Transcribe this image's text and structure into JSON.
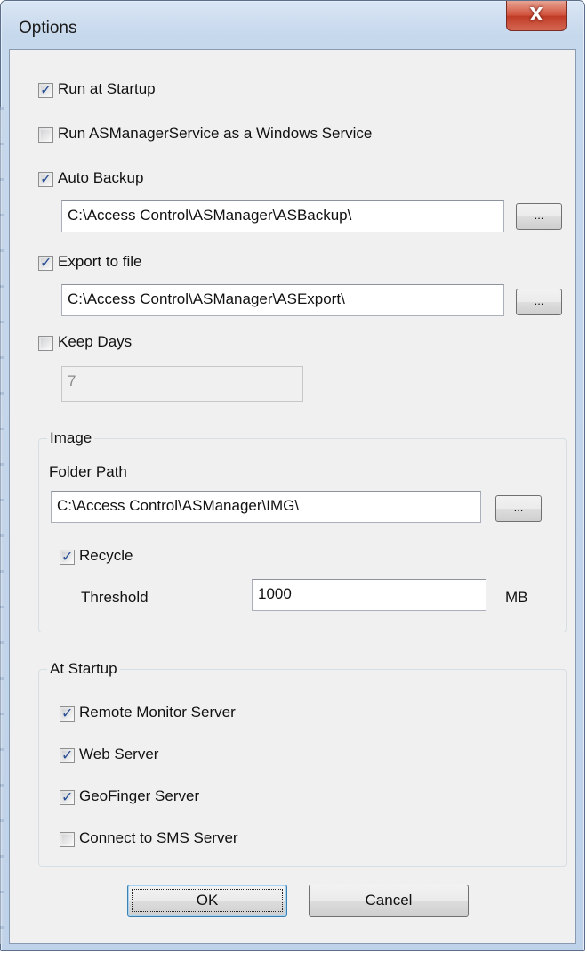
{
  "window": {
    "title": "Options",
    "close_glyph": "X"
  },
  "options": {
    "run_at_startup": {
      "label": "Run at Startup",
      "checked": true
    },
    "run_as_service": {
      "label": "Run ASManagerService as a Windows Service",
      "checked": false
    },
    "auto_backup": {
      "label": "Auto Backup",
      "checked": true,
      "path": "C:\\Access Control\\ASManager\\ASBackup\\",
      "browse_label": "..."
    },
    "export_to_file": {
      "label": "Export to file",
      "checked": true,
      "path": "C:\\Access Control\\ASManager\\ASExport\\",
      "browse_label": "..."
    },
    "keep_days": {
      "label": "Keep Days",
      "checked": false,
      "value": "7"
    }
  },
  "image_group": {
    "title": "Image",
    "folder_path_label": "Folder Path",
    "folder_path": "C:\\Access Control\\ASManager\\IMG\\",
    "browse_label": "...",
    "recycle": {
      "label": "Recycle",
      "checked": true
    },
    "threshold_label": "Threshold",
    "threshold_value": "1000",
    "threshold_unit": "MB"
  },
  "startup_group": {
    "title": "At Startup",
    "items": [
      {
        "label": "Remote Monitor Server",
        "checked": true
      },
      {
        "label": "Web Server",
        "checked": true
      },
      {
        "label": "GeoFinger Server",
        "checked": true
      },
      {
        "label": "Connect to SMS Server",
        "checked": false
      }
    ]
  },
  "buttons": {
    "ok": "OK",
    "cancel": "Cancel"
  },
  "icons": {
    "check": "checkmark-icon",
    "close": "close-icon"
  },
  "colors": {
    "check": "#2a4f94",
    "close_button": "#c9432e",
    "dialog_bg": "#f0f0f0"
  }
}
